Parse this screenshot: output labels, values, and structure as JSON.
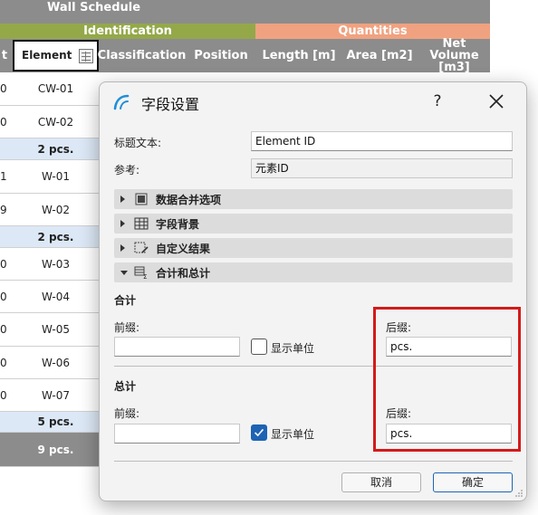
{
  "schedule": {
    "title": "Wall Schedule",
    "groups": {
      "identification": "Identification",
      "quantities": "Quantities"
    },
    "headers": {
      "partial_left": "t",
      "element": "Element",
      "classification": "Classification",
      "position": "Position",
      "length": "Length [m]",
      "area": "Area [m2]",
      "net_volume": "Net Volume [m3]"
    },
    "rows": [
      {
        "type": "data",
        "left": "0",
        "id": "CW-01"
      },
      {
        "type": "data",
        "left": "0",
        "id": "CW-02"
      },
      {
        "type": "subtotal",
        "left": "",
        "id": "2 pcs."
      },
      {
        "type": "data",
        "left": "1",
        "id": "W-01"
      },
      {
        "type": "data",
        "left": "9",
        "id": "W-02"
      },
      {
        "type": "subtotal",
        "left": "",
        "id": "2 pcs."
      },
      {
        "type": "data",
        "left": "0",
        "id": "W-03"
      },
      {
        "type": "data",
        "left": "0",
        "id": "W-04"
      },
      {
        "type": "data",
        "left": "0",
        "id": "W-05"
      },
      {
        "type": "data",
        "left": "0",
        "id": "W-06"
      },
      {
        "type": "data",
        "left": "0",
        "id": "W-07"
      },
      {
        "type": "subtotal",
        "left": "",
        "id": "5 pcs."
      },
      {
        "type": "grand",
        "left": "",
        "id": "9 pcs."
      }
    ]
  },
  "dialog": {
    "title": "字段设置",
    "help": "?",
    "header_text_label": "标题文本:",
    "header_text_value": "Element ID",
    "reference_label": "参考:",
    "reference_value": "元素ID",
    "sections": [
      {
        "label": "数据合并选项",
        "icon": "merge-icon",
        "expanded": false
      },
      {
        "label": "字段背景",
        "icon": "table-grid-icon",
        "expanded": false
      },
      {
        "label": "自定义结果",
        "icon": "custom-result-icon",
        "expanded": false
      },
      {
        "label": "合计和总计",
        "icon": "sum-icon",
        "expanded": true
      }
    ],
    "subtotal": {
      "heading": "合计",
      "prefix_label": "前缀:",
      "prefix_value": "",
      "show_unit_label": "显示单位",
      "show_unit_checked": false,
      "suffix_label": "后缀:",
      "suffix_value": "pcs."
    },
    "total": {
      "heading": "总计",
      "prefix_label": "前缀:",
      "prefix_value": "",
      "show_unit_label": "显示单位",
      "show_unit_checked": true,
      "suffix_label": "后缀:",
      "suffix_value": "pcs."
    },
    "cancel_label": "取消",
    "ok_label": "确定"
  },
  "colors": {
    "header_gray": "#8c8c8c",
    "identification_green": "#94a84a",
    "quantities_orange": "#f0a280",
    "subtotal_blue": "#dce8f6",
    "accent_blue": "#1e63b4",
    "highlight_red": "#d41a1a"
  }
}
